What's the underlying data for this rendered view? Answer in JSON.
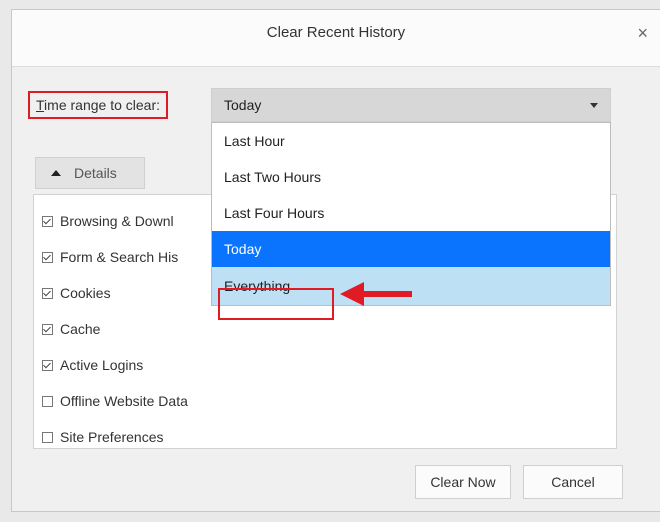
{
  "dialog": {
    "title": "Clear Recent History",
    "close_glyph": "×"
  },
  "time_range": {
    "label_accel": "T",
    "label_rest": "ime range to clear:",
    "selected_value": "Today",
    "options": [
      "Last Hour",
      "Last Two Hours",
      "Last Four Hours",
      "Today",
      "Everything"
    ],
    "highlighted_option": "Everything"
  },
  "details": {
    "toggle_label": "Details",
    "items": [
      {
        "label": "Browsing & Downl",
        "checked": true
      },
      {
        "label": "Form & Search His",
        "checked": true
      },
      {
        "label": "Cookies",
        "checked": true
      },
      {
        "label": "Cache",
        "checked": true
      },
      {
        "label": "Active Logins",
        "checked": true
      },
      {
        "label": "Offline Website Data",
        "checked": false
      },
      {
        "label": "Site Preferences",
        "checked": false
      }
    ]
  },
  "buttons": {
    "clear_now": "Clear Now",
    "cancel": "Cancel"
  },
  "colors": {
    "annotation_red": "#e01b24",
    "selected_blue": "#0a74ff",
    "hover_blue": "#bde0f5"
  }
}
